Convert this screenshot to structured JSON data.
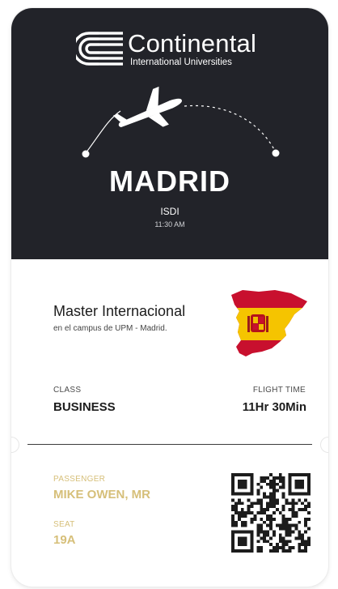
{
  "brand": {
    "name": "Continental",
    "subtitle": "International Universities"
  },
  "destination": {
    "city": "MADRID",
    "code": "ISDI",
    "time": "11:30 AM"
  },
  "program": {
    "title": "Master Internacional",
    "subtitle": "en el campus de UPM - Madrid."
  },
  "class": {
    "label": "CLASS",
    "value": "BUSINESS"
  },
  "flight_time": {
    "label": "FLIGHT TIME",
    "value": "11Hr 30Min"
  },
  "passenger": {
    "label": "PASSENGER",
    "value": "MIKE OWEN, MR"
  },
  "seat": {
    "label": "SEAT",
    "value": "19A"
  },
  "colors": {
    "header_bg": "#222329",
    "accent_gold": "#d6bf79",
    "flag_red": "#c8102e",
    "flag_yellow": "#f5c400"
  },
  "icons": [
    "continental-logo-icon",
    "airplane-icon",
    "spain-flag-map-icon",
    "qr-code-icon"
  ]
}
